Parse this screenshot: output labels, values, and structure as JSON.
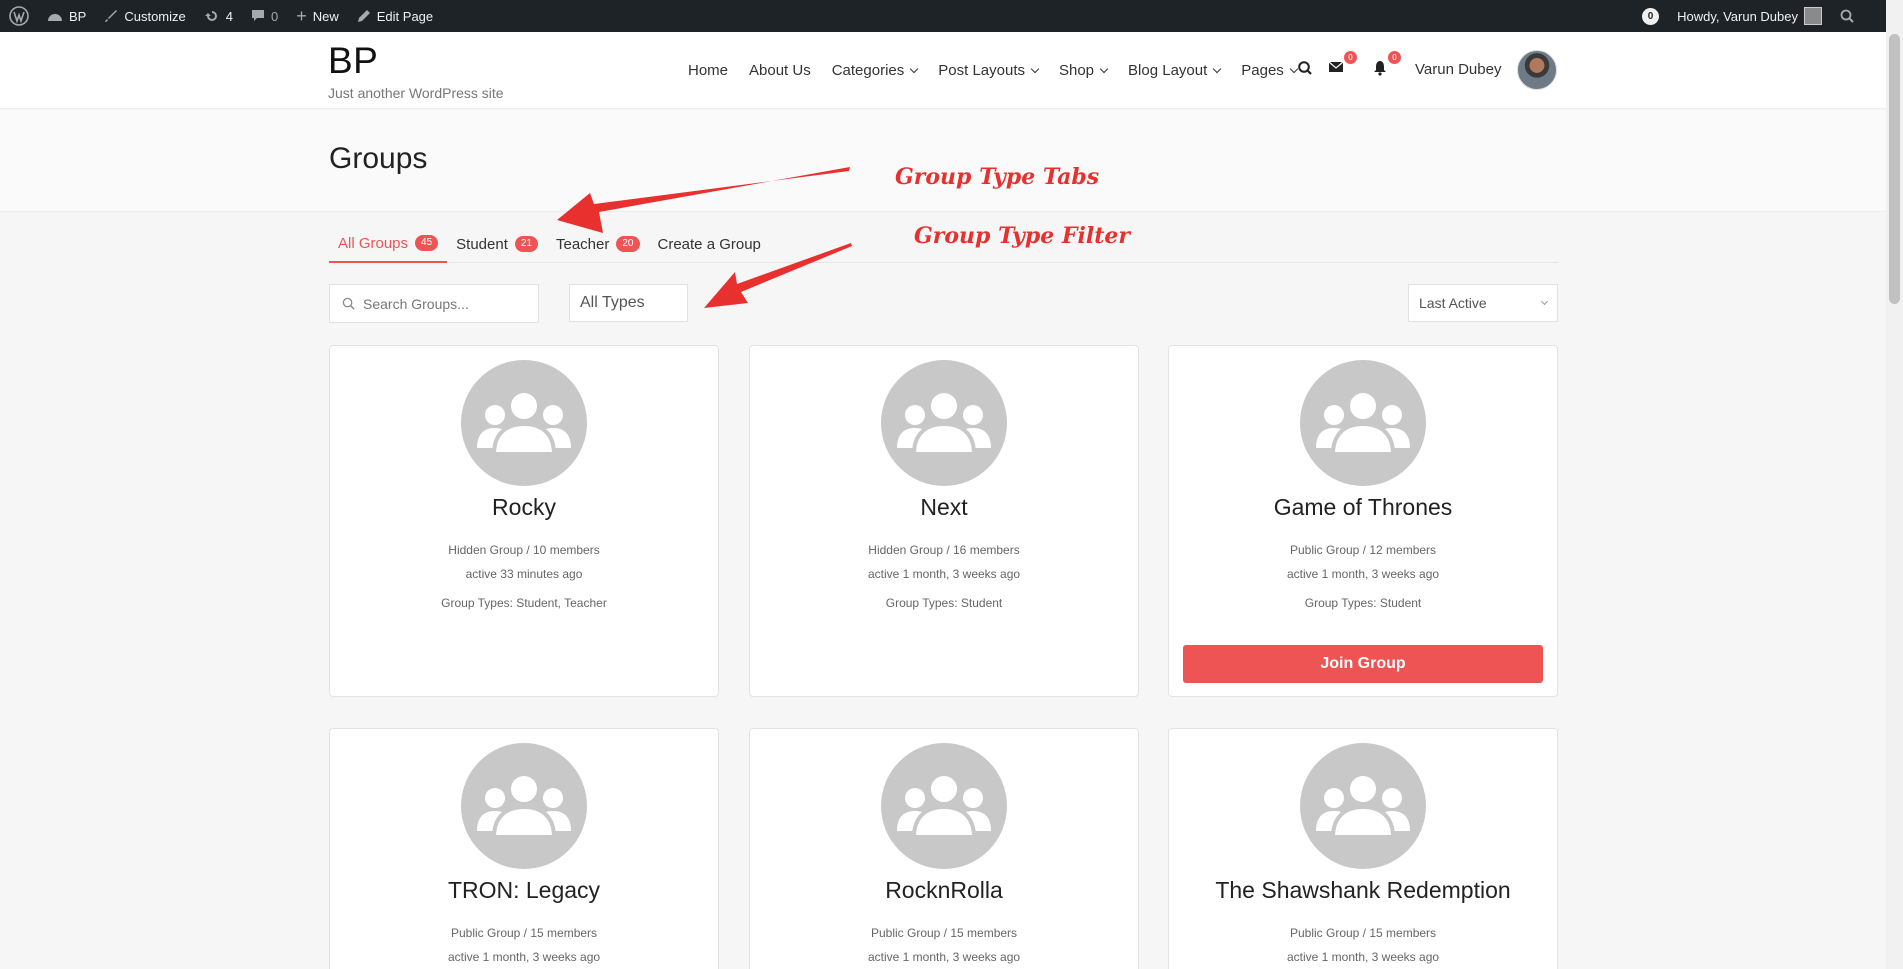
{
  "adminbar": {
    "site": "BP",
    "customize": "Customize",
    "updates": "4",
    "comments": "0",
    "new": "New",
    "edit": "Edit Page",
    "notif_count": "0",
    "howdy": "Howdy, Varun Dubey"
  },
  "site": {
    "title": "BP",
    "tagline": "Just another WordPress site"
  },
  "nav": {
    "items": [
      {
        "label": "Home"
      },
      {
        "label": "About Us"
      },
      {
        "label": "Categories"
      },
      {
        "label": "Post Layouts"
      },
      {
        "label": "Shop"
      },
      {
        "label": "Blog Layout"
      },
      {
        "label": "Pages"
      }
    ],
    "messages_count": "0",
    "notifications_count": "0",
    "user_name": "Varun Dubey"
  },
  "page": {
    "title": "Groups"
  },
  "annotations": {
    "tabs": "Group Type Tabs",
    "filter": "Group Type Filter"
  },
  "tabs": [
    {
      "label": "All Groups",
      "count": "45"
    },
    {
      "label": "Student",
      "count": "21"
    },
    {
      "label": "Teacher",
      "count": "20"
    },
    {
      "label": "Create a Group"
    }
  ],
  "filters": {
    "search_placeholder": "Search Groups...",
    "type_value": "All Types",
    "order_value": "Last Active"
  },
  "groups": [
    {
      "name": "Rocky",
      "status": "Hidden Group / 10 members",
      "active": "active 33 minutes ago",
      "types": "Group Types: Student, Teacher"
    },
    {
      "name": "Next",
      "status": "Hidden Group / 16 members",
      "active": "active 1 month, 3 weeks ago",
      "types": "Group Types: Student"
    },
    {
      "name": "Game of Thrones",
      "status": "Public Group / 12 members",
      "active": "active 1 month, 3 weeks ago",
      "types": "Group Types: Student",
      "button": "Join Group"
    },
    {
      "name": "TRON: Legacy",
      "status": "Public Group / 15 members",
      "active": "active 1 month, 3 weeks ago"
    },
    {
      "name": "RocknRolla",
      "status": "Public Group / 15 members",
      "active": "active 1 month, 3 weeks ago"
    },
    {
      "name": "The Shawshank Redemption",
      "status": "Public Group / 15 members",
      "active": "active 1 month, 3 weeks ago"
    }
  ],
  "colors": {
    "accent": "#ef5455",
    "adminbar": "#1d2327",
    "annotation": "#e8302f",
    "avatar_bg": "#c8c8c8"
  }
}
